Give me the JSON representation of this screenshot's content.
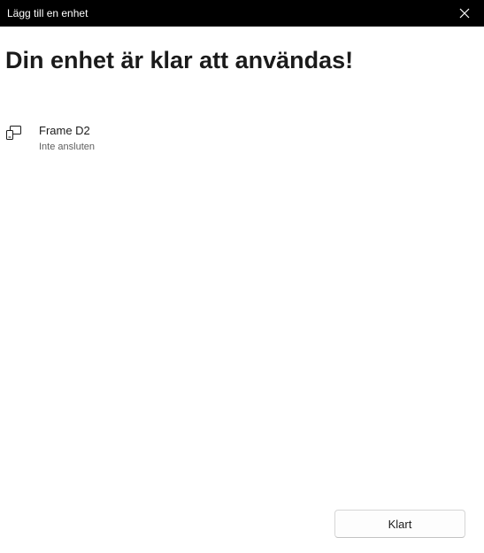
{
  "window": {
    "title": "Lägg till en enhet",
    "close_icon": "close-icon"
  },
  "main": {
    "heading": "Din enhet är klar att användas!",
    "device": {
      "icon": "display-device-icon",
      "name": "Frame D2",
      "status": "Inte ansluten"
    }
  },
  "footer": {
    "done_label": "Klart"
  }
}
